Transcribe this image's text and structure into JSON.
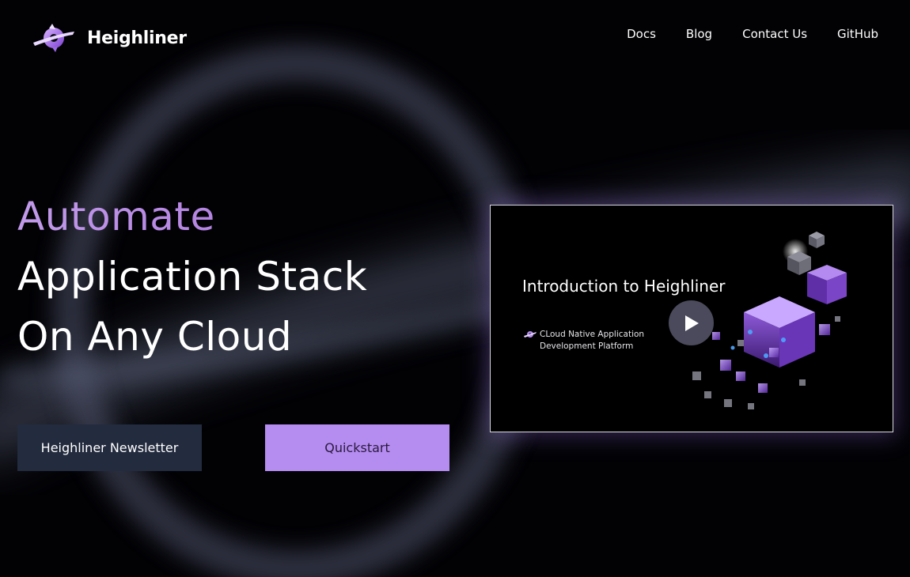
{
  "brand": {
    "name": "Heighliner",
    "accent": "#b58cf0"
  },
  "nav": {
    "items": [
      {
        "label": "Docs"
      },
      {
        "label": "Blog"
      },
      {
        "label": "Contact Us"
      },
      {
        "label": "GitHub"
      }
    ]
  },
  "hero": {
    "line1": "Automate",
    "line2": "Application Stack",
    "line3": "On Any Cloud"
  },
  "buttons": {
    "newsletter_label": "Heighliner Newsletter",
    "quickstart_label": "Quickstart"
  },
  "video": {
    "title": "Introduction to Heighliner",
    "subtitle": "CLoud Native Application Development Platform",
    "play_icon": "play-icon"
  },
  "colors": {
    "background": "#020205",
    "accent_text": "#b88ce6",
    "newsletter_bg": "#232b3e",
    "quickstart_bg": "#b58cf0"
  }
}
